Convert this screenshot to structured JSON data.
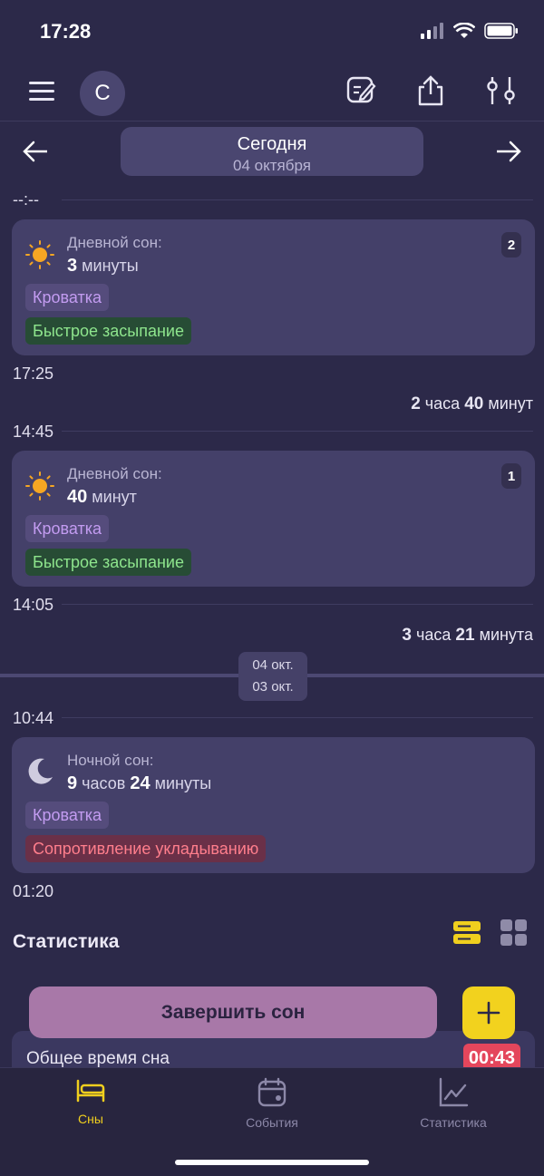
{
  "status_bar": {
    "time": "17:28"
  },
  "header": {
    "avatar_letter": "С"
  },
  "date_nav": {
    "title": "Сегодня",
    "date": "04 октября"
  },
  "timeline": {
    "top_label": "--:--",
    "entries": [
      {
        "type": "Дневной сон:",
        "dur_num1": "3",
        "dur_unit1": "минуты",
        "dur_num2": "",
        "dur_unit2": "",
        "badge": "2",
        "tags": [
          "Кроватка",
          "Быстрое засыпание"
        ],
        "end_time": "17:25"
      },
      {
        "type": "Дневной сон:",
        "dur_num1": "40",
        "dur_unit1": "минут",
        "dur_num2": "",
        "dur_unit2": "",
        "badge": "1",
        "tags": [
          "Кроватка",
          "Быстрое засыпание"
        ],
        "start_time": "14:45",
        "end_time": "14:05"
      },
      {
        "type": "Ночной сон:",
        "dur_num1": "9",
        "dur_unit1": "часов",
        "dur_num2": "24",
        "dur_unit2": "минуты",
        "tags": [
          "Кроватка",
          "Сопротивление укладыванию"
        ],
        "start_time": "10:44",
        "end_time": "01:20"
      }
    ],
    "gaps": [
      {
        "num1": "2",
        "unit1": "часа",
        "num2": "40",
        "unit2": "минут"
      },
      {
        "num1": "3",
        "unit1": "часа",
        "num2": "21",
        "unit2": "минута"
      }
    ],
    "day_sep": {
      "upper": "04 окт.",
      "lower": "03 окт."
    }
  },
  "stats": {
    "title": "Статистика",
    "rows": [
      {
        "label": "Общее время сна",
        "value": "00:43"
      }
    ]
  },
  "actions": {
    "finish_label": "Завершить сон"
  },
  "bottom_nav": [
    {
      "label": "Сны",
      "icon": "bed-icon",
      "active": true
    },
    {
      "label": "События",
      "icon": "calendar-icon",
      "active": false
    },
    {
      "label": "Статистика",
      "icon": "chart-icon",
      "active": false
    }
  ],
  "colors": {
    "accent": "#f0cf1e",
    "background": "#2c2949",
    "card": "#444069"
  }
}
